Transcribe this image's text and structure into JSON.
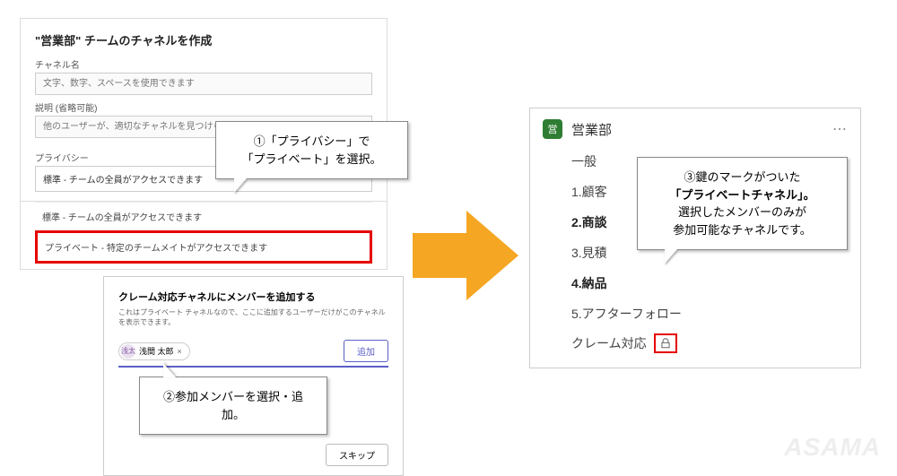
{
  "panel1": {
    "title": "\"営業部\" チームのチャネルを作成",
    "name_label": "チャネル名",
    "name_placeholder": "文字、数字、スペースを使用できます",
    "desc_label": "説明 (省略可能)",
    "desc_placeholder": "他のユーザーが、適切なチャネルを見つけられるように説明を入力します",
    "privacy_label": "プライバシー",
    "privacy_selected": "標準 - チームの全員がアクセスできます",
    "privacy_options": [
      "標準 - チームの全員がアクセスできます",
      "プライベート - 特定のチームメイトがアクセスできます"
    ]
  },
  "panel2": {
    "title": "クレーム対応チャネルにメンバーを追加する",
    "note": "これはプライベート チャネルなので、ここに追加するユーザーだけがこのチャネルを表示できます。",
    "chip_initials": "浅太",
    "chip_name": "浅間 太郎",
    "add_button": "追加",
    "skip_button": "スキップ"
  },
  "panel3": {
    "team_initial": "営",
    "team_name": "営業部",
    "channels": [
      {
        "label": "一般",
        "bold": false
      },
      {
        "label": "1.顧客",
        "bold": false
      },
      {
        "label": "2.商談",
        "bold": true
      },
      {
        "label": "3.見積",
        "bold": false
      },
      {
        "label": "4.納品",
        "bold": true
      },
      {
        "label": "5.アフターフォロー",
        "bold": false
      }
    ],
    "private_channel": "クレーム対応"
  },
  "callouts": {
    "c1_l1": "①「プライバシー」で",
    "c1_l2": "「プライベート」を選択。",
    "c2": "②参加メンバーを選択・追加。",
    "c3_l1": "③鍵のマークがついた",
    "c3_l2": "「プライベートチャネル」。",
    "c3_l3": "選択したメンバーのみが",
    "c3_l4": "参加可能なチャネルです。"
  },
  "watermark": "ASAMA"
}
